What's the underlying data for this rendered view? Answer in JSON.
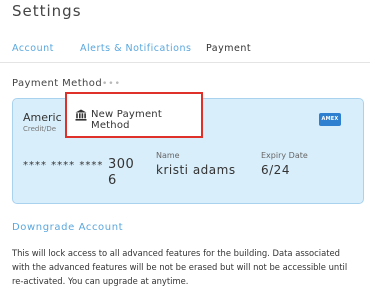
{
  "page": {
    "title": "Settings"
  },
  "tabs": [
    {
      "label": "Account",
      "active": false
    },
    {
      "label": "Alerts & Notifications",
      "active": false
    },
    {
      "label": "Payment",
      "active": true
    }
  ],
  "payment_method": {
    "section_label": "Payment Method",
    "more_icon": "ellipsis-icon",
    "card": {
      "brand_label": "Americ",
      "card_type_label": "Credit/De",
      "badge_icon": "amex-card-icon",
      "badge_text": "AMEX",
      "number_mask": "**** **** ****",
      "number_last": "300 6",
      "name_label": "Name",
      "name_value": "kristi adams",
      "expiry_label": "Expiry Date",
      "expiry_value": "6/24"
    },
    "menu": {
      "item_icon": "bank-icon",
      "item_label": "New Payment Method"
    }
  },
  "downgrade": {
    "link_label": "Downgrade Account",
    "description": "This will lock access to all advanced features for the building. Data associated with the advanced features will be not be erased but will not be accessible until re-activated. You can upgrade at anytime."
  },
  "colors": {
    "accent": "#5aa7dd",
    "card_bg": "#d9eefb",
    "highlight": "#e0302a"
  }
}
